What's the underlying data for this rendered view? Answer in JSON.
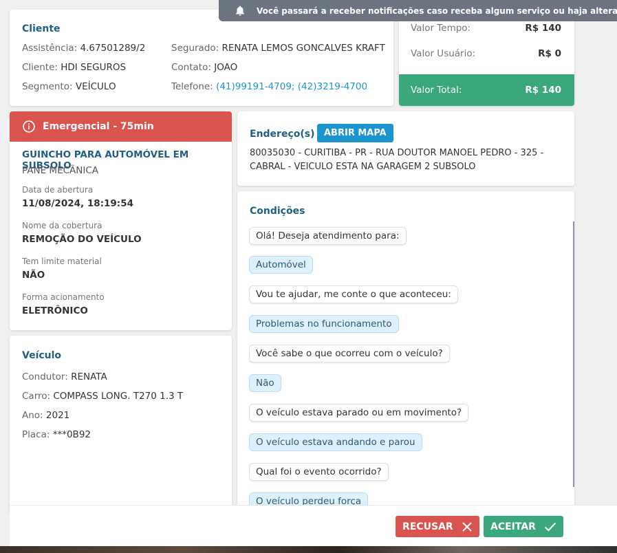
{
  "notification": {
    "text": "Você passará a receber notificações caso receba algum serviço ou haja alteração de algum",
    "icon": "bell-icon"
  },
  "cliente": {
    "title": "Cliente",
    "assistencia_label": "Assistência:",
    "assistencia_value": "4.67501289/2",
    "cliente_label": "Cliente:",
    "cliente_value": "HDI SEGUROS",
    "segmento_label": "Segmento:",
    "segmento_value": "VEÍCULO",
    "segurado_label": "Segurado:",
    "segurado_value": "RENATA LEMOS GONCALVES KRAFT",
    "contato_label": "Contato:",
    "contato_value": "JOAO",
    "telefone_label": "Telefone:",
    "telefone_value": "(41)99191-4709; (42)3219-4700"
  },
  "valores": {
    "tempo_label": "Valor Tempo:",
    "tempo_value": "R$ 140",
    "usuario_label": "Valor Usuário:",
    "usuario_value": "R$ 0",
    "total_label": "Valor Total:",
    "total_value": "R$ 140",
    "total_color": "#3aa87b"
  },
  "servico": {
    "banner": "Emergencial - 75min",
    "banner_color": "#d9534f",
    "title": "GUINCHO PARA AUTOMÓVEL EM SUBSOLO",
    "subtitle": "PANE MECÂNICA",
    "abertura_label": "Data de abertura",
    "abertura_value": "11/08/2024, 18:19:54",
    "cobertura_label": "Nome da cobertura",
    "cobertura_value": "REMOÇÃO DO VEÍCULO",
    "limite_label": "Tem limite material",
    "limite_value": "NÃO",
    "acionamento_label": "Forma acionamento",
    "acionamento_value": "ELETRÔNICO"
  },
  "veiculo": {
    "title": "Veículo",
    "condutor_label": "Condutor:",
    "condutor_value": "RENATA",
    "carro_label": "Carro:",
    "carro_value": "COMPASS LONG. T270 1.3 T",
    "ano_label": "Ano:",
    "ano_value": "2021",
    "placa_label": "Placa:",
    "placa_value": "***0B92"
  },
  "endereco": {
    "title": "Endereço(s)",
    "map_button": "ABRIR MAPA",
    "line1": "80035030 - CURITIBA - PR - RUA DOUTOR MANOEL PEDRO - 325 -",
    "line2": "CABRAL - VEICULO ESTA NA GARAGEM 2 SUBSOLO"
  },
  "condicoes": {
    "title": "Condições",
    "messages": [
      "Olá! Deseja atendimento para:",
      "Automóvel",
      "Vou te ajudar, me conte o que aconteceu:",
      "Problemas no funcionamento",
      "Você sabe o que ocorreu com o veículo?",
      "Não",
      "O veículo estava parado ou em movimento?",
      "O veículo estava andando e parou",
      "Qual foi o evento ocorrido?",
      "O veículo perdeu força"
    ]
  },
  "actions": {
    "refuse": "RECUSAR",
    "refuse_color": "#d9534f",
    "accept": "ACEITAR",
    "accept_color": "#3aa87b"
  }
}
